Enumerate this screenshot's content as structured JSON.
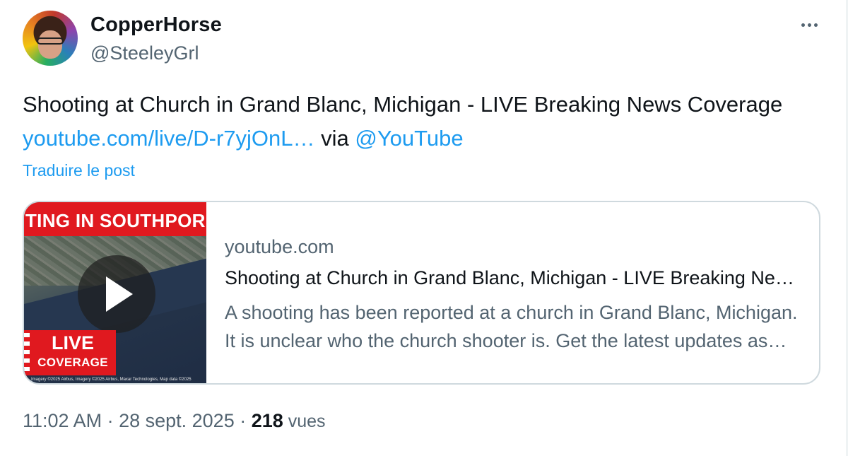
{
  "author": {
    "name": "CopperHorse",
    "handle": "@SteeleyGrl"
  },
  "tweet": {
    "text_part1": "Shooting at Church in Grand Blanc, Michigan - LIVE Breaking News Coverage ",
    "link": "youtube.com/live/D-r7yjOnL…",
    "via": " via ",
    "mention": "@YouTube",
    "translate_label": "Traduire le post"
  },
  "card": {
    "thumbnail": {
      "banner_text": "TING IN SOUTHPOR",
      "live_label": "LIVE",
      "coverage_label": "COVERAGE",
      "credit": "Imagery ©2025 Airbus, Imagery ©2025 Airbus, Maxar Technologies, Map data ©2025"
    },
    "domain": "youtube.com",
    "title": "Shooting at Church in Grand Blanc, Michigan - LIVE Breaking News Coverage",
    "description": "A shooting has been reported at a church in Grand Blanc, Michigan. It is unclear who the church shooter is. Get the latest updates as details emerge."
  },
  "meta": {
    "time": "11:02 AM",
    "separator": " · ",
    "date": "28 sept. 2025",
    "separator2": " · ",
    "views_count": "218",
    "views_label": " vues"
  },
  "icons": {
    "more": "more-horizontal-icon",
    "play": "play-icon"
  },
  "colors": {
    "link": "#1d9bf0",
    "secondary_text": "#536471",
    "live_red": "#e0191f"
  }
}
